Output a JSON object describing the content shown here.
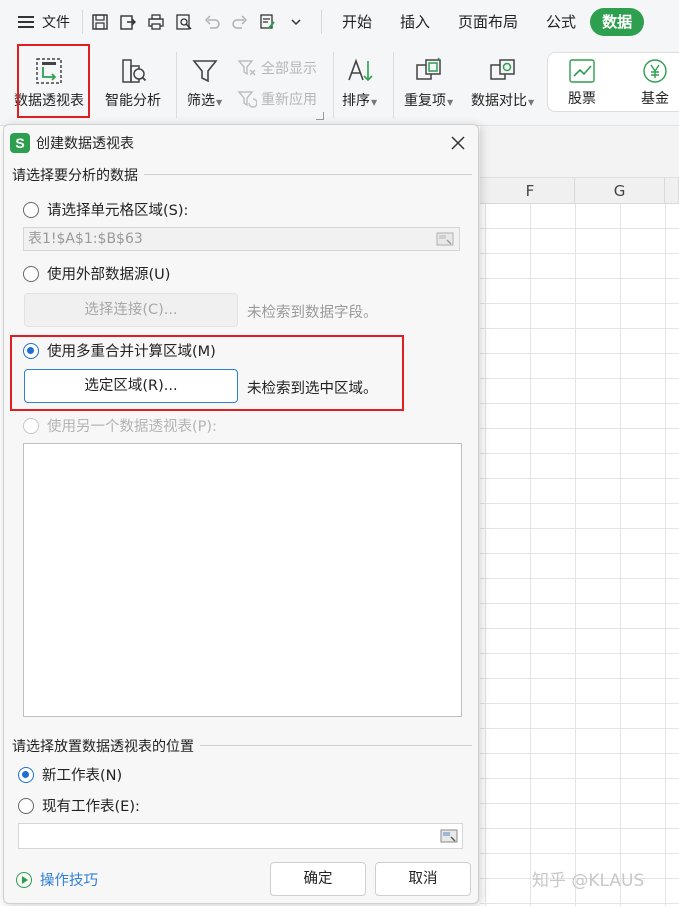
{
  "menubar": {
    "file_label": "文件",
    "tabs": [
      "开始",
      "插入",
      "页面布局",
      "公式",
      "数据"
    ],
    "active_tab": "数据"
  },
  "ribbon": {
    "pivot_table": "数据透视表",
    "smart_analysis": "智能分析",
    "filter": "筛选",
    "show_all": "全部显示",
    "reapply": "重新应用",
    "sort": "排序",
    "duplicates": "重复项",
    "data_compare": "数据对比",
    "stocks": "股票",
    "funds": "基金"
  },
  "sheet": {
    "columns": [
      "F",
      "G"
    ]
  },
  "dialog": {
    "title": "创建数据透视表",
    "section_data": "请选择要分析的数据",
    "option_range": "请选择单元格区域(S):",
    "range_value": "表1!$A$1:$B$63",
    "option_external": "使用外部数据源(U)",
    "select_connection": "选择连接(C)...",
    "no_fields": "未检索到数据字段。",
    "option_multi": "使用多重合并计算区域(M)",
    "select_region": "选定区域(R)...",
    "no_region": "未检索到选中区域。",
    "option_other_pivot": "使用另一个数据透视表(P):",
    "section_place": "请选择放置数据透视表的位置",
    "option_new_sheet": "新工作表(N)",
    "option_existing_sheet": "现有工作表(E):",
    "existing_value": "",
    "tips": "操作技巧",
    "ok": "确定",
    "cancel": "取消"
  },
  "watermark": "知乎 @KLAUS",
  "colors": {
    "accent_green": "#2e9e4f",
    "highlight_red": "#e02020",
    "radio_blue": "#1e6fd0"
  }
}
